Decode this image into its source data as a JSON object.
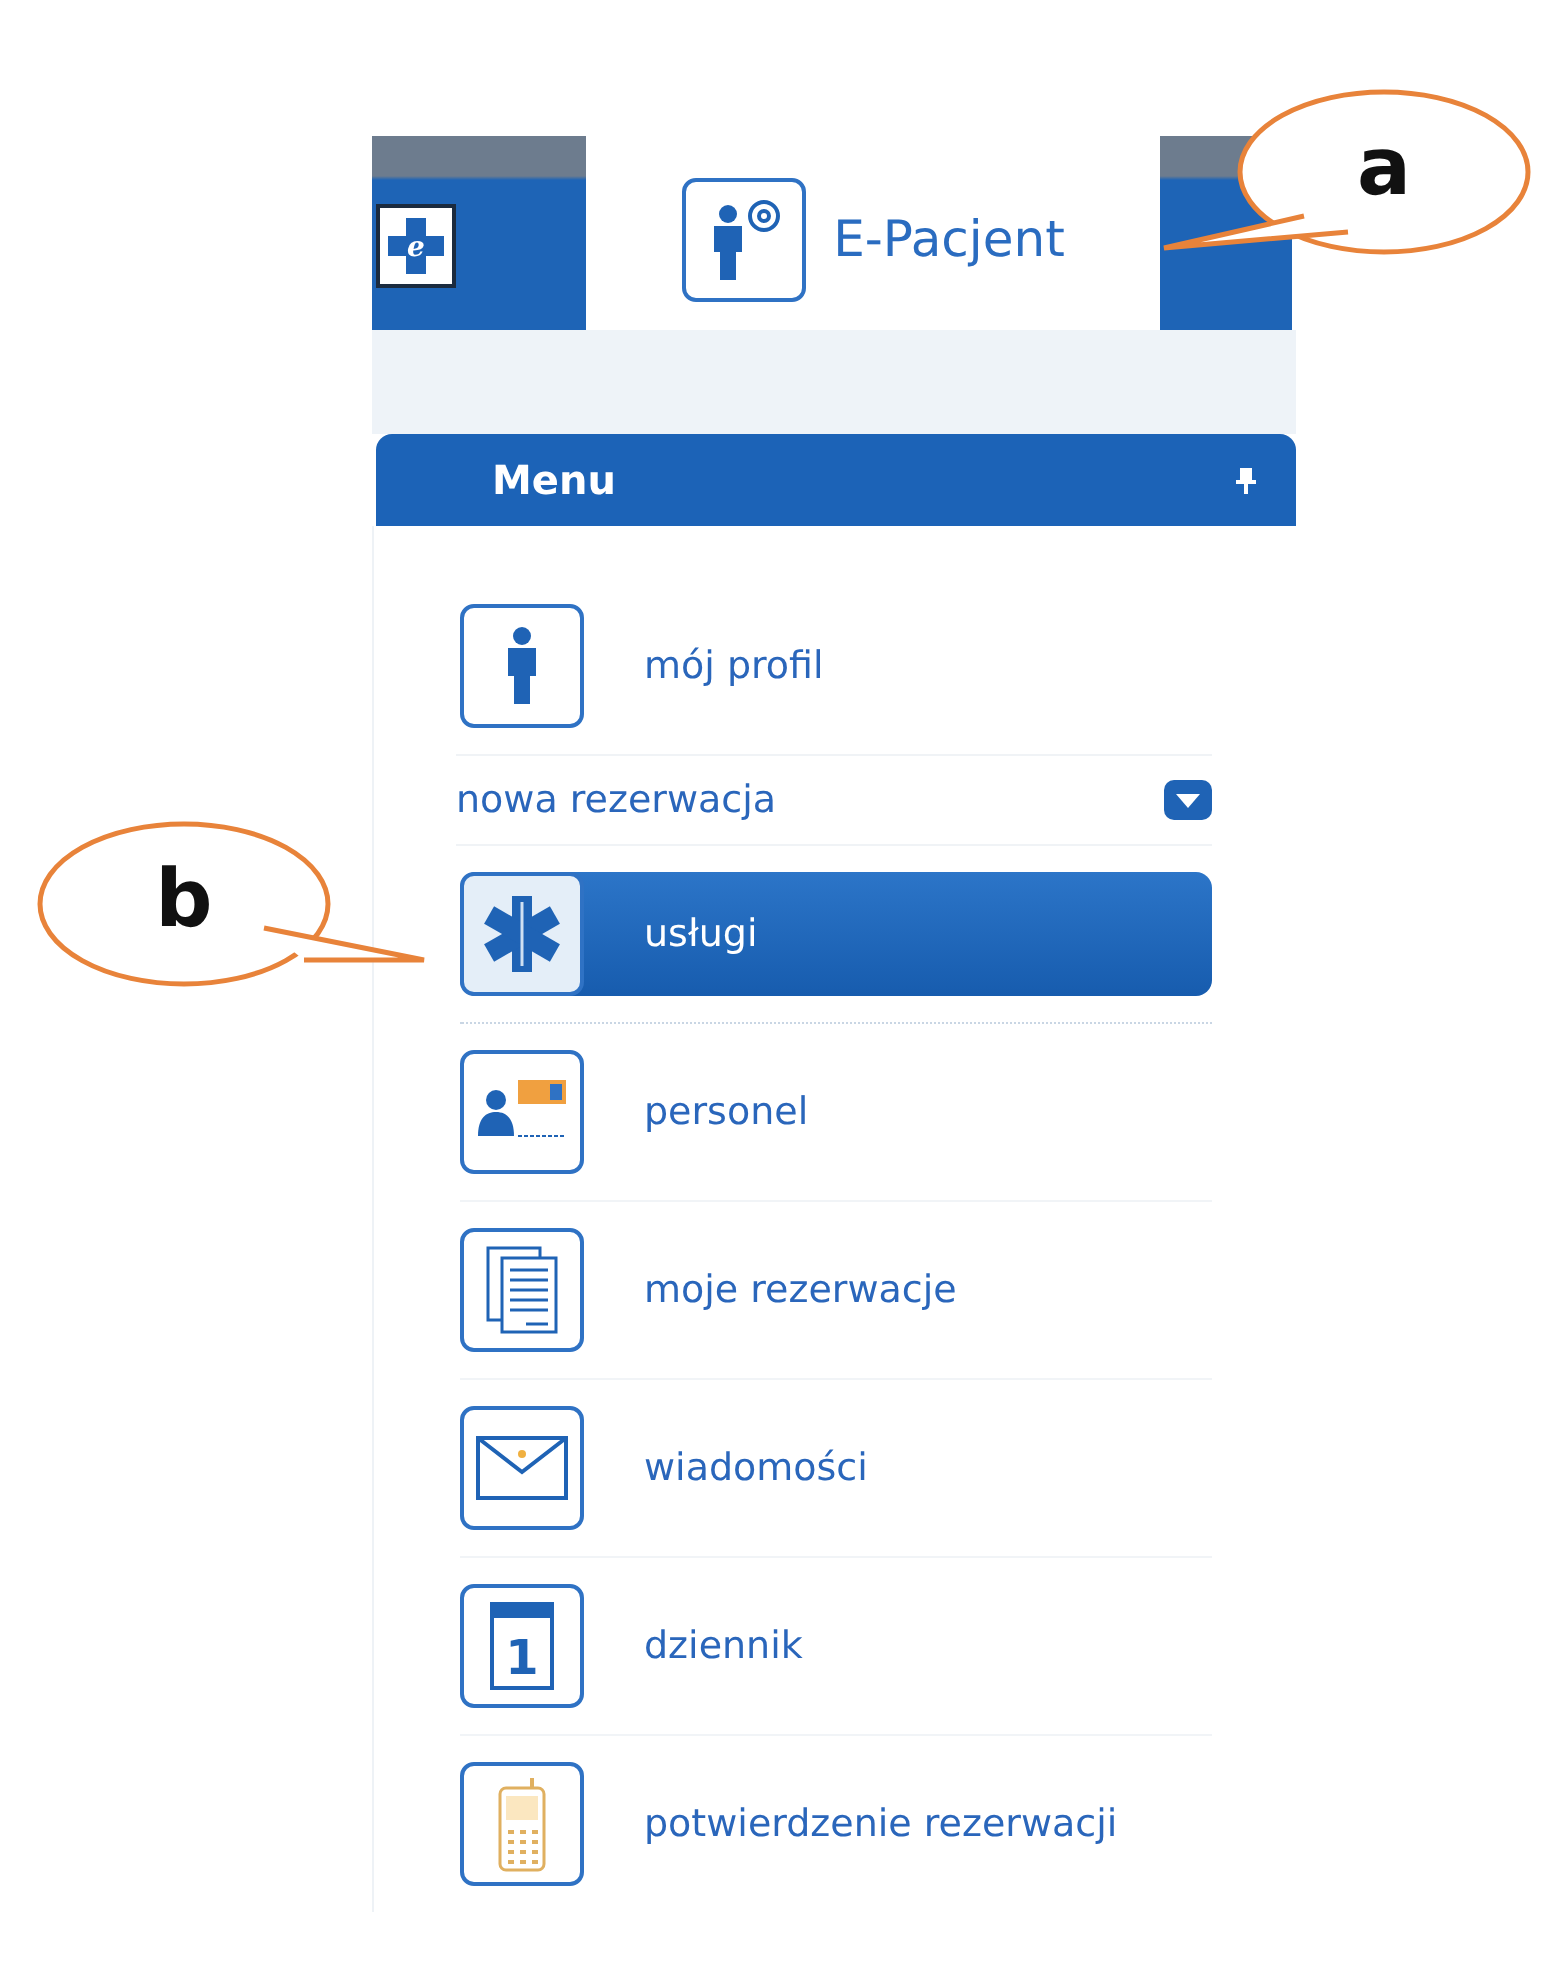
{
  "header": {
    "logo_letter": "e",
    "tab_title": "E-Pacjent"
  },
  "menu": {
    "title": "Menu",
    "items": [
      {
        "kind": "item",
        "label": "mój profil",
        "selected": false
      },
      {
        "kind": "group",
        "label": "nowa rezerwacja",
        "expanded": true
      },
      {
        "kind": "item",
        "label": "usługi",
        "selected": true
      },
      {
        "kind": "item",
        "label": "personel",
        "selected": false
      },
      {
        "kind": "item",
        "label": "moje rezerwacje",
        "selected": false
      },
      {
        "kind": "item",
        "label": "wiadomości",
        "selected": false
      },
      {
        "kind": "item",
        "label": "dziennik",
        "selected": false,
        "icon_text": "1"
      },
      {
        "kind": "item",
        "label": "potwierdzenie rezerwacji",
        "selected": false
      }
    ]
  },
  "callouts": [
    {
      "label": "a"
    },
    {
      "label": "b"
    }
  ]
}
